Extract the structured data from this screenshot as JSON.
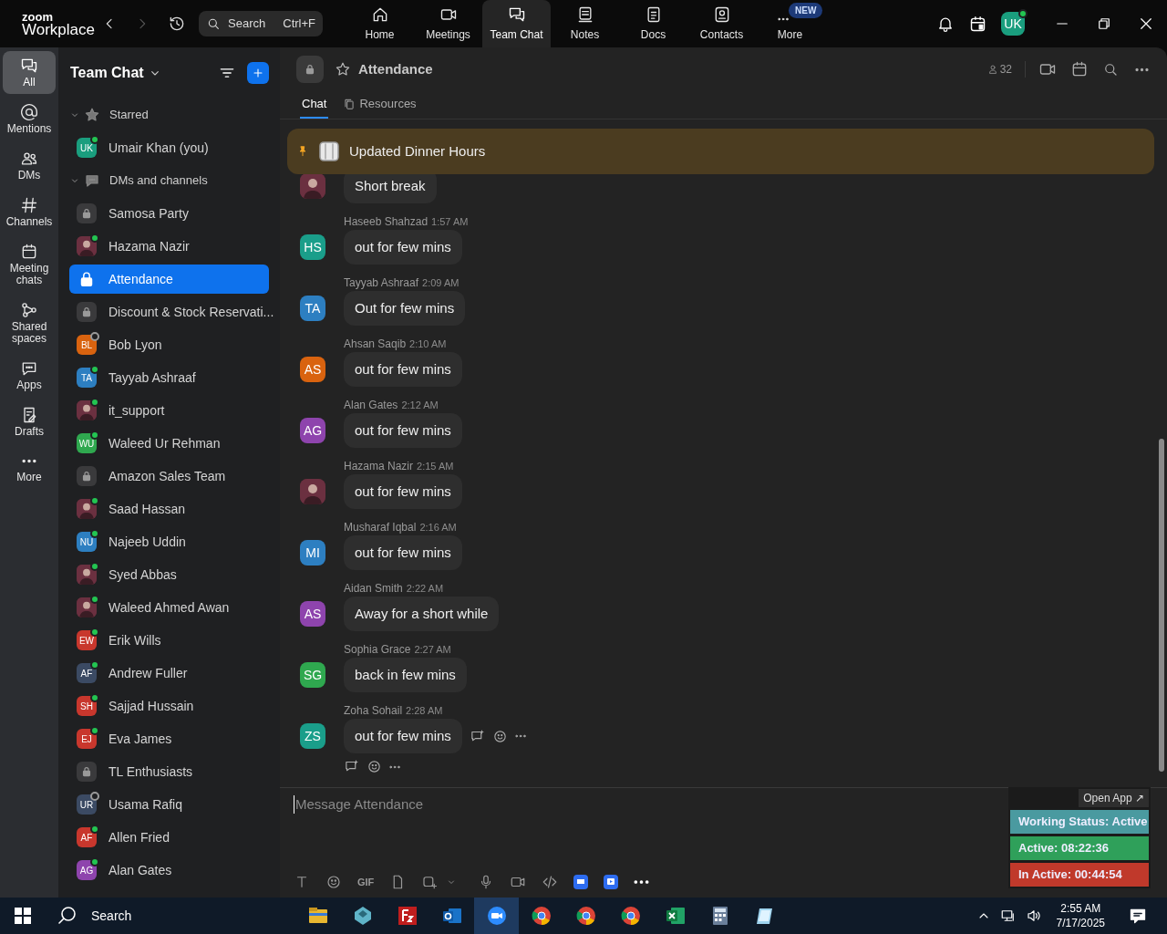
{
  "app": {
    "logo_top": "zoom",
    "logo_bottom": "Workplace"
  },
  "search": {
    "placeholder": "Search",
    "shortcut": "Ctrl+F"
  },
  "nav_tabs": [
    {
      "label": "Home",
      "selected": false
    },
    {
      "label": "Meetings",
      "selected": false
    },
    {
      "label": "Team Chat",
      "selected": true
    },
    {
      "label": "Notes",
      "selected": false
    },
    {
      "label": "Docs",
      "selected": false
    },
    {
      "label": "Contacts",
      "selected": false
    },
    {
      "label": "More",
      "selected": false,
      "badge": "NEW"
    }
  ],
  "profile": {
    "initials": "UK",
    "color": "#1a9e7e"
  },
  "rail": [
    {
      "label": "All",
      "selected": true
    },
    {
      "label": "Mentions",
      "selected": false
    },
    {
      "label": "DMs",
      "selected": false
    },
    {
      "label": "Channels",
      "selected": false
    },
    {
      "label": "Meeting chats",
      "selected": false
    },
    {
      "label": "Shared spaces",
      "selected": false
    },
    {
      "label": "Apps",
      "selected": false
    },
    {
      "label": "Drafts",
      "selected": false
    },
    {
      "label": "More",
      "selected": false
    }
  ],
  "sidebar": {
    "title": "Team Chat",
    "sections": [
      {
        "label": "Starred",
        "expanded": true,
        "items": [
          {
            "name": "Umair Khan (you)",
            "kind": "initials",
            "initials": "UK",
            "color": "#1a9e7e",
            "online": true,
            "selected": false
          }
        ]
      },
      {
        "label": "DMs and channels",
        "expanded": true,
        "items": [
          {
            "name": "Samosa Party",
            "kind": "lock",
            "selected": false
          },
          {
            "name": "Hazama Nazir",
            "kind": "photo",
            "online": true,
            "selected": false
          },
          {
            "name": "Attendance",
            "kind": "lock",
            "selected": true
          },
          {
            "name": "Discount & Stock Reservati...",
            "kind": "lock",
            "selected": false
          },
          {
            "name": "Bob Lyon",
            "kind": "initials",
            "initials": "BL",
            "color": "#d9630f",
            "online": false,
            "selected": false
          },
          {
            "name": "Tayyab Ashraaf",
            "kind": "initials",
            "initials": "TA",
            "color": "#2d7fc1",
            "online": true,
            "selected": false
          },
          {
            "name": "it_support",
            "kind": "photo",
            "online": true,
            "selected": false
          },
          {
            "name": "Waleed Ur Rehman",
            "kind": "initials",
            "initials": "WU",
            "color": "#2fa84f",
            "online": true,
            "selected": false
          },
          {
            "name": "Amazon Sales Team",
            "kind": "lock",
            "selected": false
          },
          {
            "name": "Saad Hassan",
            "kind": "photo",
            "online": true,
            "selected": false
          },
          {
            "name": "Najeeb Uddin",
            "kind": "initials",
            "initials": "NU",
            "color": "#2d7fc1",
            "online": true,
            "selected": false
          },
          {
            "name": "Syed Abbas",
            "kind": "photo",
            "online": true,
            "selected": false
          },
          {
            "name": "Waleed Ahmed Awan",
            "kind": "photo",
            "online": true,
            "selected": false
          },
          {
            "name": "Erik Wills",
            "kind": "initials",
            "initials": "EW",
            "color": "#c8372d",
            "online": true,
            "selected": false
          },
          {
            "name": "Andrew Fuller",
            "kind": "initials",
            "initials": "AF",
            "color": "#3b4a63",
            "online": true,
            "selected": false
          },
          {
            "name": "Sajjad Hussain",
            "kind": "initials",
            "initials": "SH",
            "color": "#c8372d",
            "online": true,
            "selected": false
          },
          {
            "name": "Eva James",
            "kind": "initials",
            "initials": "EJ",
            "color": "#c8372d",
            "online": true,
            "selected": false
          },
          {
            "name": "TL Enthusiasts",
            "kind": "lock",
            "selected": false
          },
          {
            "name": "Usama Rafiq",
            "kind": "initials",
            "initials": "UR",
            "color": "#3b4a63",
            "online": false,
            "selected": false
          },
          {
            "name": "Allen Fried",
            "kind": "initials",
            "initials": "AF",
            "color": "#c8372d",
            "online": true,
            "selected": false
          },
          {
            "name": "Alan Gates",
            "kind": "initials",
            "initials": "AG",
            "color": "#8e44ad",
            "online": true,
            "selected": false
          }
        ]
      }
    ]
  },
  "channel": {
    "title": "Attendance",
    "member_count": "32",
    "tabs": [
      {
        "label": "Chat",
        "selected": true
      },
      {
        "label": "Resources",
        "selected": false
      }
    ]
  },
  "pinned": {
    "text": "Updated Dinner Hours"
  },
  "messages": [
    {
      "kind": "photo",
      "text": "Short break"
    },
    {
      "sender": "Haseeb Shahzad",
      "time": "1:57 AM",
      "kind": "initials",
      "initials": "HS",
      "color": "#1a9e8a",
      "text": "out for few mins"
    },
    {
      "sender": "Tayyab Ashraaf",
      "time": "2:09 AM",
      "kind": "initials",
      "initials": "TA",
      "color": "#2d7fc1",
      "text": "Out for few mins"
    },
    {
      "sender": "Ahsan Saqib",
      "time": "2:10 AM",
      "kind": "initials",
      "initials": "AS",
      "color": "#d9630f",
      "text": "out for few mins"
    },
    {
      "sender": "Alan Gates",
      "time": "2:12 AM",
      "kind": "initials",
      "initials": "AG",
      "color": "#8e44ad",
      "text": "out for few mins"
    },
    {
      "sender": "Hazama Nazir",
      "time": "2:15 AM",
      "kind": "photo",
      "text": "out for few mins"
    },
    {
      "sender": "Musharaf Iqbal",
      "time": "2:16 AM",
      "kind": "initials",
      "initials": "MI",
      "color": "#2d7fc1",
      "text": "out for few mins"
    },
    {
      "sender": "Aidan Smith",
      "time": "2:22 AM",
      "kind": "initials",
      "initials": "AS",
      "color": "#8e44ad",
      "text": "Away for a short while"
    },
    {
      "sender": "Sophia Grace",
      "time": "2:27 AM",
      "kind": "initials",
      "initials": "SG",
      "color": "#2fa84f",
      "text": "back in few mins"
    },
    {
      "sender": "Zoha Sohail",
      "time": "2:28 AM",
      "kind": "initials",
      "initials": "ZS",
      "color": "#1a9e8a",
      "text": "out for few mins"
    }
  ],
  "composer": {
    "placeholder": "Message Attendance",
    "toolbar": [
      "GIF"
    ]
  },
  "overlay": {
    "open_app": "Open App ↗",
    "statuses": [
      {
        "text": "Working Status: Active",
        "color": "#4a9aa0"
      },
      {
        "text": "Active: 08:22:36",
        "color": "#2fa05a"
      },
      {
        "text": "In Active: 00:44:54",
        "color": "#c0392b"
      }
    ]
  },
  "taskbar": {
    "search": "Search",
    "time": "2:55 AM",
    "date": "7/17/2025"
  }
}
